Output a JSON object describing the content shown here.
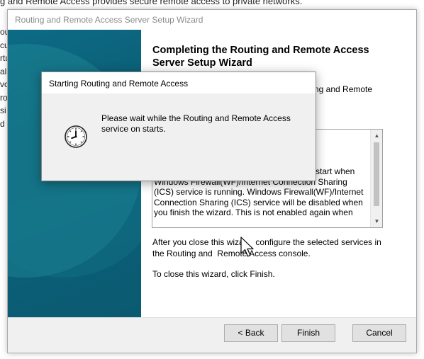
{
  "background": {
    "top_text": "g and Remote Access provides secure remote access to private networks.",
    "left_fragments": [
      "ou",
      "cu",
      "rtu",
      "al-",
      "vo",
      "ro",
      "si",
      "d a"
    ]
  },
  "wizard": {
    "title": "Routing and Remote Access Server Setup Wizard",
    "heading": "Completing the Routing and Remote Access Server Setup Wizard",
    "intro": "ng and Remote",
    "summary_text": "start when Windows Firewall(WF)/Internet Connection Sharing (ICS) service is running. Windows Firewall(WF)/Internet Connection Sharing (ICS) service will be disabled when you finish the wizard. This is not enabled again when",
    "after_text": "After you close this wiza     configure the selected services in the Routing and  Remote Access console.",
    "close_text": "To close this wizard, click Finish.",
    "buttons": {
      "back": "< Back",
      "finish": "Finish",
      "cancel": "Cancel"
    },
    "side_color": "#0a5e75"
  },
  "dialog": {
    "title": "Starting Routing and Remote Access",
    "message": "Please wait while the Routing and Remote Access service on  starts.",
    "icon": "clock-icon"
  },
  "cursor": {
    "icon": "arrow-cursor-icon"
  }
}
